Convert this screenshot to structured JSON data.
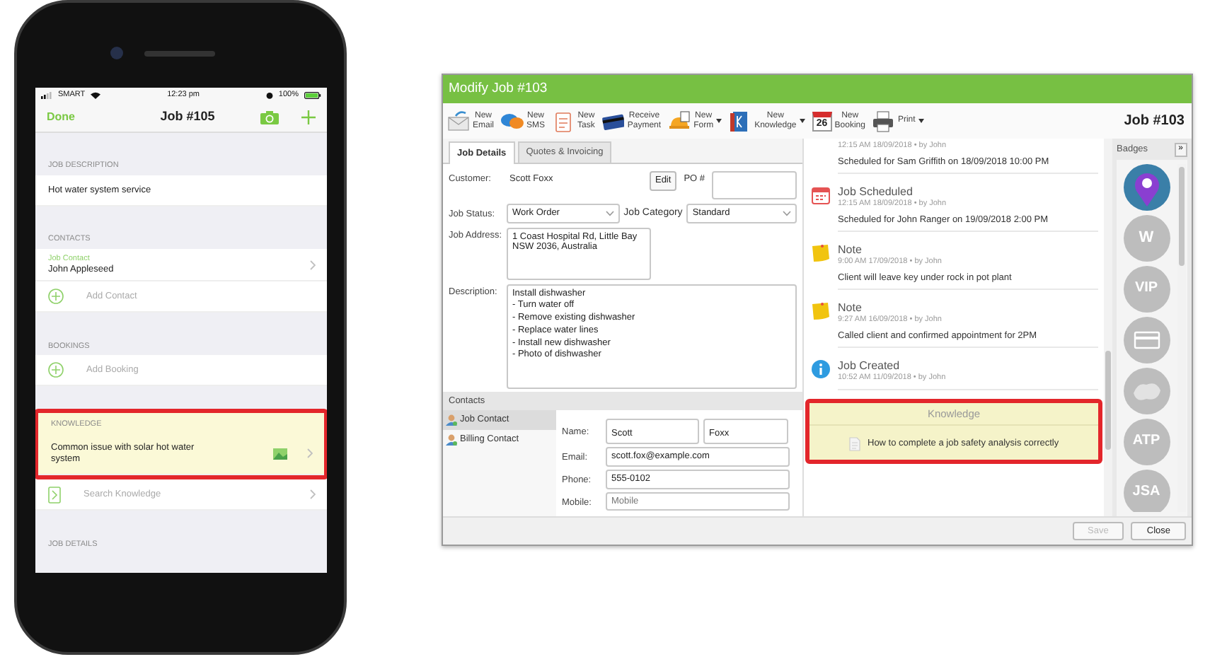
{
  "phone": {
    "status_bar": {
      "carrier": "SMART",
      "time": "12:23 pm",
      "battery": "100%"
    },
    "nav": {
      "done": "Done",
      "title": "Job #105"
    },
    "sections": [
      {
        "header": "JOB DESCRIPTION",
        "highlighted": false,
        "rows": [
          {
            "kind": "text",
            "text": "Hot water system service",
            "highlighted": false
          }
        ]
      },
      {
        "header": "CONTACTS",
        "highlighted": false,
        "rows": [
          {
            "kind": "contact",
            "label": "Job Contact",
            "text": "John Appleseed",
            "highlighted": false
          },
          {
            "kind": "add",
            "text": "Add Contact",
            "highlighted": false
          }
        ]
      },
      {
        "header": "BOOKINGS",
        "highlighted": false,
        "rows": [
          {
            "kind": "add",
            "text": "Add Booking",
            "highlighted": false
          }
        ]
      },
      {
        "header": "KNOWLEDGE",
        "highlighted": true,
        "rows": [
          {
            "kind": "article",
            "text": "Common issue with solar hot water system",
            "highlighted": true
          },
          {
            "kind": "search",
            "text": "Search Knowledge",
            "highlighted": false
          }
        ]
      },
      {
        "header": "JOB DETAILS",
        "highlighted": false
      }
    ]
  },
  "window": {
    "title": "Modify Job #103",
    "job_number": "Job #103",
    "toolbar": [
      {
        "kind": "email",
        "lines": [
          "New",
          "Email"
        ],
        "dropdown": false
      },
      {
        "kind": "sms",
        "lines": [
          "New",
          "SMS"
        ],
        "dropdown": false
      },
      {
        "kind": "task",
        "lines": [
          "New",
          "Task"
        ],
        "dropdown": false
      },
      {
        "kind": "payment",
        "lines": [
          "Receive",
          "Payment"
        ],
        "dropdown": false
      },
      {
        "kind": "form",
        "lines": [
          "New",
          "Form"
        ],
        "dropdown": true
      },
      {
        "kind": "knowledge",
        "lines": [
          "New",
          "Knowledge"
        ],
        "dropdown": true
      },
      {
        "kind": "booking",
        "icon_text": "26",
        "lines": [
          "New",
          "Booking"
        ],
        "dropdown": false
      },
      {
        "kind": "print",
        "lines": [
          "Print"
        ],
        "dropdown": true
      }
    ],
    "tabs": [
      {
        "label": "Job Details",
        "selected": true
      },
      {
        "label": "Quotes & Invoicing",
        "selected": false
      }
    ],
    "form": {
      "customer_label": "Customer:",
      "customer": "Scott Foxx",
      "edit": "Edit",
      "po_label": "PO #",
      "status_label": "Job Status:",
      "status": "Work Order",
      "category_label": "Job Category",
      "category": "Standard",
      "address_label": "Job Address:",
      "address": [
        "1 Coast Hospital Rd, Little Bay",
        "NSW 2036, Australia"
      ],
      "description_label": "Description:",
      "description": [
        "Install dishwasher",
        "- Turn water off",
        "- Remove existing dishwasher",
        "- Replace water lines",
        "- Install new dishwasher",
        "- Photo of dishwasher"
      ]
    },
    "contacts": {
      "header": "Contacts",
      "items": [
        {
          "label": "Job Contact",
          "selected": true
        },
        {
          "label": "Billing Contact",
          "selected": false
        }
      ],
      "name_label": "Name:",
      "first_name": "Scott",
      "last_name": "Foxx",
      "email_label": "Email:",
      "email": "scott.fox@example.com",
      "phone_label": "Phone:",
      "phone": "555-0102",
      "mobile_label": "Mobile:",
      "mobile_placeholder": "Mobile"
    },
    "timeline": [
      {
        "kind": "schedule",
        "meta": "12:15 AM 18/09/2018 •  by John",
        "body": "Scheduled for Sam Griffith on 18/09/2018 10:00 PM"
      },
      {
        "kind": "schedule",
        "title": "Job Scheduled",
        "meta": "12:15 AM 18/09/2018 •  by John",
        "body": "Scheduled for John Ranger on 19/09/2018 2:00 PM"
      },
      {
        "kind": "note",
        "title": "Note",
        "meta": "9:00 AM 17/09/2018 •  by John",
        "body": "Client will leave key under rock in pot plant"
      },
      {
        "kind": "note",
        "title": "Note",
        "meta": "9:27 AM 16/09/2018 •  by John",
        "body": "Called client and confirmed appointment for 2PM"
      },
      {
        "kind": "info",
        "title": "Job Created",
        "meta": "10:52 AM 11/09/2018 •  by John"
      }
    ],
    "knowledge": {
      "title": "Knowledge",
      "items": [
        "How to complete a job safety analysis correctly"
      ]
    },
    "badges": {
      "title": "Badges",
      "toggle": "»",
      "items": [
        {
          "kind": "pin"
        },
        {
          "kind": "text",
          "label": "W"
        },
        {
          "kind": "text",
          "label": "VIP"
        },
        {
          "kind": "card"
        },
        {
          "kind": "blob"
        },
        {
          "kind": "text",
          "label": "ATP"
        },
        {
          "kind": "text",
          "label": "JSA"
        }
      ]
    },
    "buttons": [
      {
        "label": "Save",
        "disabled": true
      },
      {
        "label": "Close",
        "disabled": false
      }
    ]
  }
}
